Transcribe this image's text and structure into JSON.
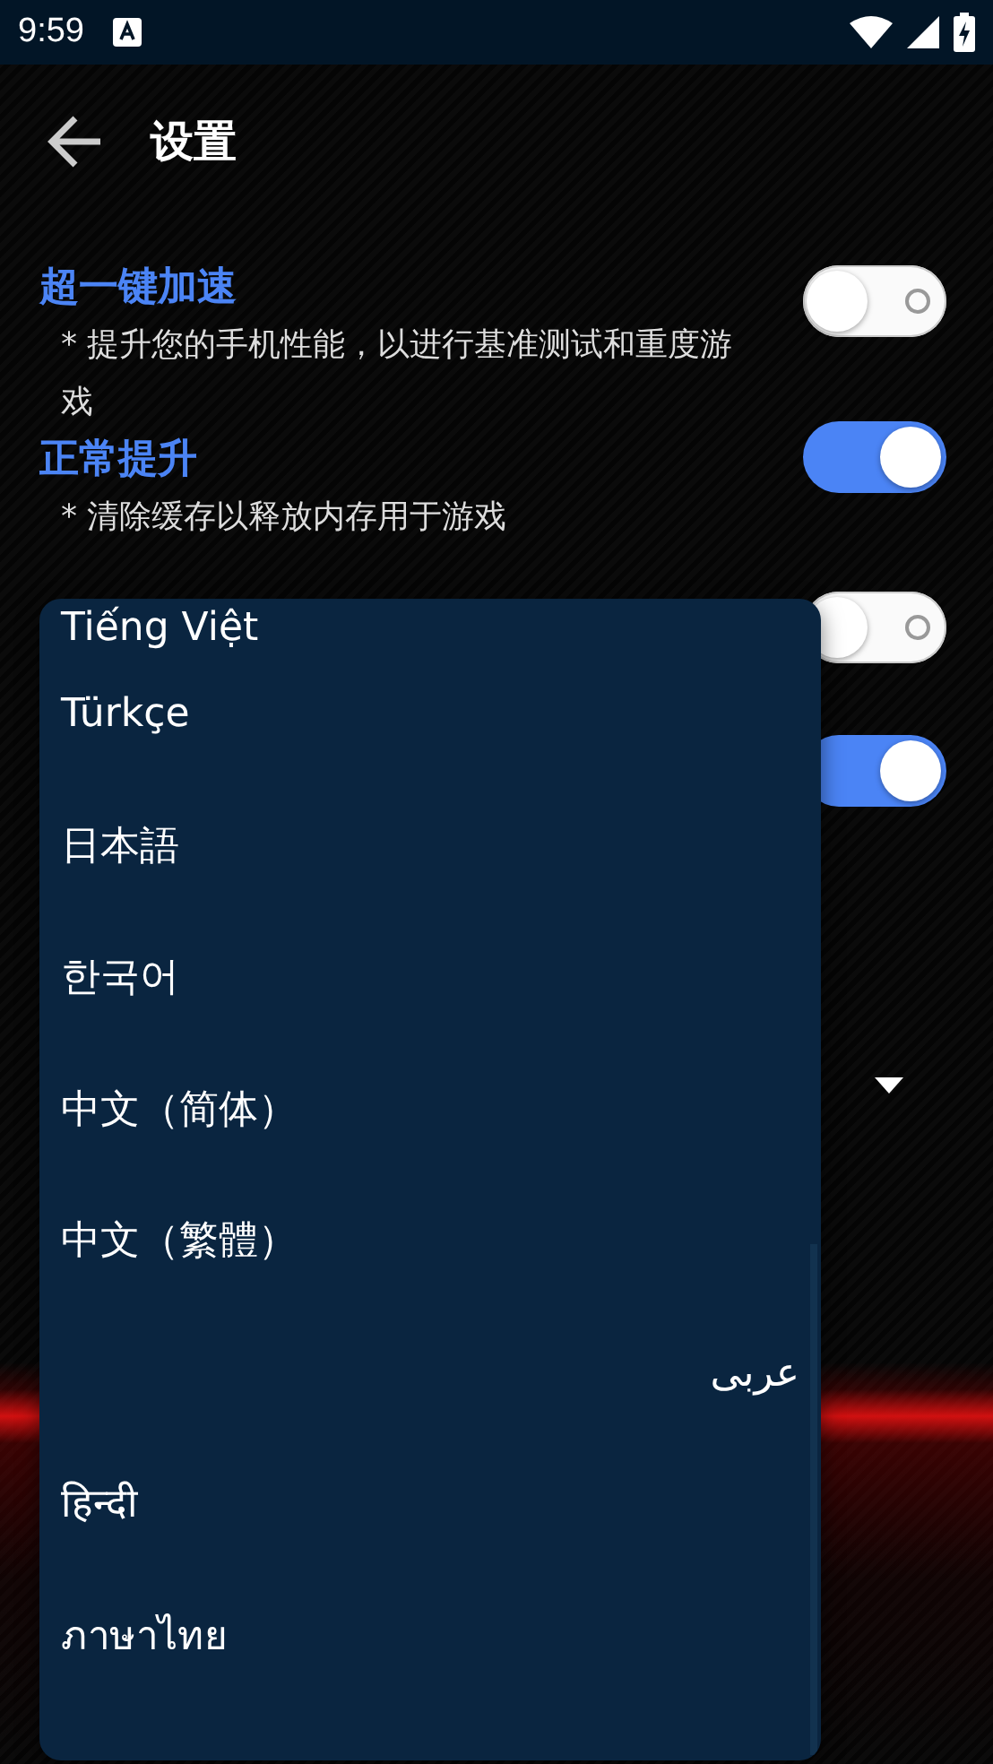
{
  "status_bar": {
    "time": "9:59"
  },
  "app_bar": {
    "title": "设置"
  },
  "settings": [
    {
      "kind": "toggle",
      "title": "超一键加速",
      "description": "* 提升您的手机性能，以进行基准测试和重度游戏",
      "on": false
    },
    {
      "kind": "toggle",
      "title": "正常提升",
      "description": "* 清除缓存以释放内存用于游戏",
      "on": true
    },
    {
      "kind": "toggle",
      "on": false
    },
    {
      "kind": "toggle",
      "on": true
    },
    {
      "kind": "dropdown"
    }
  ],
  "language_menu": {
    "items": [
      {
        "label": "Tiếng Việt",
        "rtl": false
      },
      {
        "label": "Türkçe",
        "rtl": false
      },
      {
        "label": "日本語",
        "rtl": false
      },
      {
        "label": "한국어",
        "rtl": false
      },
      {
        "label": "中文（简体）",
        "rtl": false
      },
      {
        "label": "中文（繁體）",
        "rtl": false
      },
      {
        "label": "عربى",
        "rtl": true
      },
      {
        "label": "हिन्दी",
        "rtl": false
      },
      {
        "label": "ภาษาไทย",
        "rtl": false
      }
    ]
  }
}
